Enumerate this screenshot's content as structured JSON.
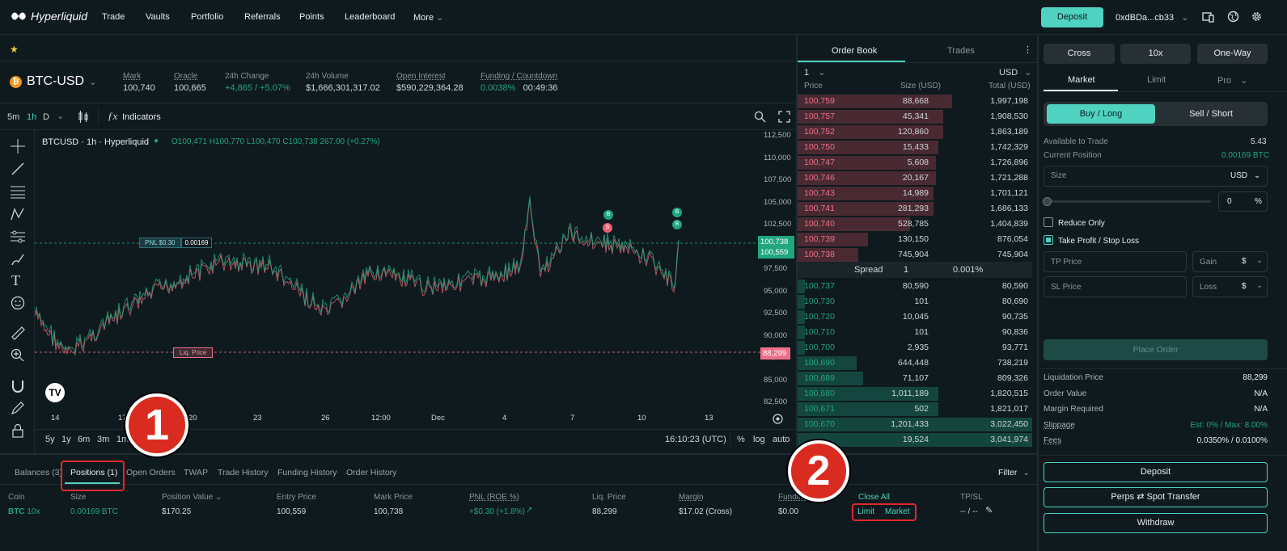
{
  "nav": {
    "brand": "Hyperliquid",
    "items": [
      "Trade",
      "Vaults",
      "Portfolio",
      "Referrals",
      "Points",
      "Leaderboard",
      "More"
    ],
    "deposit": "Deposit",
    "wallet": "0xdBDa...cb33"
  },
  "market": {
    "pair": "BTC-USD",
    "stats": [
      {
        "label": "Mark",
        "value": "100,740"
      },
      {
        "label": "Oracle",
        "value": "100,665"
      },
      {
        "label": "24h Change",
        "value": "+4,865 / +5.07%"
      },
      {
        "label": "24h Volume",
        "value": "$1,666,301,317.02"
      },
      {
        "label": "Open Interest",
        "value": "$590,229,364.28"
      },
      {
        "label": "Funding / Countdown",
        "value": "0.0038%",
        "value2": "00:49:36"
      }
    ]
  },
  "chart": {
    "intervals": [
      "5m",
      "1h",
      "D"
    ],
    "indicators": "Indicators",
    "legend_title": "BTCUSD · 1h · Hyperliquid",
    "ohlc": "O100,471 H100,770 L100,470 C100,738 267.00 (+0.27%)",
    "price_ticks": [
      "112,500",
      "110,000",
      "107,500",
      "105,000",
      "102,500",
      "100,000",
      "97,500",
      "95,000",
      "92,500",
      "90,000",
      "87,500",
      "85,000",
      "82,500"
    ],
    "time_ticks": [
      "14",
      "17",
      "20",
      "23",
      "26",
      "12:00",
      "Dec",
      "4",
      "7",
      "10",
      "13"
    ],
    "pnl_label": "PNL $0.30",
    "pnl_size": "0.00169",
    "liq_label": "Liq. Price",
    "price_tag_1": "100,738",
    "price_tag_2": "100,559",
    "liq_tag": "88,299",
    "ranges": [
      "5y",
      "1y",
      "6m",
      "3m",
      "1m"
    ],
    "clock": "16:10:23 (UTC)",
    "opts": [
      "%",
      "log",
      "auto"
    ]
  },
  "orderbook": {
    "tabs": [
      "Order Book",
      "Trades"
    ],
    "precision": "1",
    "currency": "USD",
    "headers": [
      "Price",
      "Size (USD)",
      "Total (USD)"
    ],
    "asks": [
      [
        "100,759",
        "88,668",
        "1,997,198"
      ],
      [
        "100,757",
        "45,341",
        "1,908,530"
      ],
      [
        "100,752",
        "120,860",
        "1,863,189"
      ],
      [
        "100,750",
        "15,433",
        "1,742,329"
      ],
      [
        "100,747",
        "5,608",
        "1,726,896"
      ],
      [
        "100,746",
        "20,167",
        "1,721,288"
      ],
      [
        "100,743",
        "14,989",
        "1,701,121"
      ],
      [
        "100,741",
        "281,293",
        "1,686,133"
      ],
      [
        "100,740",
        "528,785",
        "1,404,839"
      ],
      [
        "100,739",
        "130,150",
        "876,054"
      ],
      [
        "100,738",
        "745,904",
        "745,904"
      ]
    ],
    "ask_depth": [
      0.66,
      0.62,
      0.62,
      0.6,
      0.59,
      0.59,
      0.58,
      0.58,
      0.48,
      0.3,
      0.26
    ],
    "spread": {
      "label": "Spread",
      "value": "1",
      "pct": "0.001%"
    },
    "bids": [
      [
        "100,737",
        "80,590",
        "80,590"
      ],
      [
        "100,730",
        "101",
        "80,690"
      ],
      [
        "100,720",
        "10,045",
        "90,735"
      ],
      [
        "100,710",
        "101",
        "90,836"
      ],
      [
        "100,700",
        "2,935",
        "93,771"
      ],
      [
        "100,690",
        "644,448",
        "738,219"
      ],
      [
        "100,689",
        "71,107",
        "809,326"
      ],
      [
        "100,680",
        "1,011,189",
        "1,820,515"
      ],
      [
        "100,671",
        "502",
        "1,821,017"
      ],
      [
        "100,670",
        "1,201,433",
        "3,022,450"
      ],
      [
        "",
        "19,524",
        "3,041,974"
      ]
    ],
    "bid_depth": [
      0.03,
      0.03,
      0.03,
      0.03,
      0.03,
      0.25,
      0.28,
      0.6,
      0.6,
      1.0,
      1.0
    ]
  },
  "ticket": {
    "margin_mode": "Cross",
    "leverage": "10x",
    "position_mode": "One-Way",
    "order_types": [
      "Market",
      "Limit",
      "Pro"
    ],
    "buy": "Buy / Long",
    "sell": "Sell / Short",
    "available_label": "Available to Trade",
    "available_value": "5.43",
    "position_label": "Current Position",
    "position_value": "0.00169 BTC",
    "size_label": "Size",
    "size_unit": "USD",
    "slider_pct": "0",
    "pct_sign": "%",
    "reduce_only": "Reduce Only",
    "tpsl": "Take Profit / Stop Loss",
    "tp_price": "TP Price",
    "gain": "Gain",
    "sl_price": "SL Price",
    "loss": "Loss",
    "dollar": "$",
    "place_order": "Place Order",
    "details": [
      {
        "label": "Liquidation Price",
        "value": "88,299"
      },
      {
        "label": "Order Value",
        "value": "N/A"
      },
      {
        "label": "Margin Required",
        "value": "N/A"
      },
      {
        "label": "Slippage",
        "value": "Est: 0% / Max: 8.00%"
      },
      {
        "label": "Fees",
        "value": "0.0350% / 0.0100%"
      }
    ],
    "deposit": "Deposit",
    "transfer_left": "Perps",
    "transfer_right": "Spot Transfer",
    "withdraw": "Withdraw"
  },
  "bottom": {
    "tabs": [
      "Balances (3)",
      "Positions (1)",
      "Open Orders",
      "TWAP",
      "Trade History",
      "Funding History",
      "Order History"
    ],
    "filter": "Filter",
    "columns": [
      "Coin",
      "Size",
      "Position Value",
      "Entry Price",
      "Mark Price",
      "PNL (ROE %)",
      "Liq. Price",
      "Margin",
      "Funding",
      "Close All",
      "TP/SL"
    ],
    "row": {
      "coin": "BTC",
      "lev": "10x",
      "size": "0.00169 BTC",
      "value": "$170.25",
      "entry": "100,559",
      "mark": "100,738",
      "pnl": "+$0.30 (+1.8%)",
      "liq": "88,299",
      "margin": "$17.02 (Cross)",
      "funding": "$0.00",
      "limit": "Limit",
      "market": "Market",
      "tpsl": "-- / --"
    }
  },
  "callouts": [
    "1",
    "2"
  ],
  "colors": {
    "accent": "#50d2c1",
    "bid": "#1fa67d",
    "ask": "#ed7088",
    "callout": "#d92b1f"
  }
}
